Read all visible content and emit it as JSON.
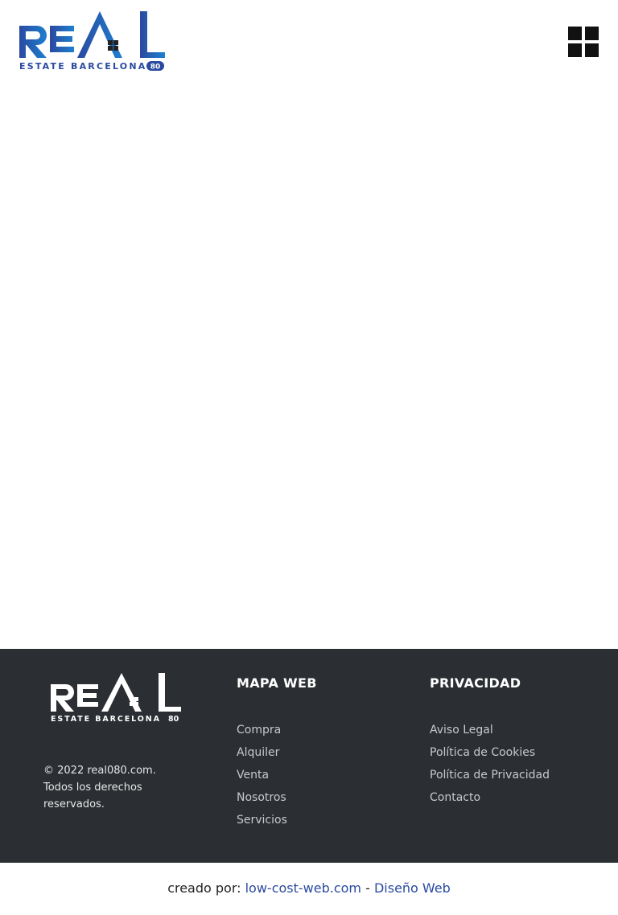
{
  "header": {
    "logo": {
      "word": "REAL",
      "tagline": "ESTATE BARCELONA",
      "badge": "80",
      "color_main": "#2a4aa0",
      "color_accent": "#1e7fd0"
    },
    "menu_icon": "grid-menu-icon"
  },
  "footer": {
    "background": "#2b2f33",
    "logo": {
      "word": "REAL",
      "tagline": "ESTATE BARCELONA",
      "badge": "80"
    },
    "copyright": "© 2022 real080.com. Todos los derechos reservados.",
    "mapa_web": {
      "title": "MAPA WEB",
      "links": [
        "Compra",
        "Alquiler",
        "Venta",
        "Nosotros",
        "Servicios"
      ]
    },
    "privacidad": {
      "title": "PRIVACIDAD",
      "links": [
        "Aviso Legal",
        "Política de Cookies",
        "Política de Privacidad",
        "Contacto"
      ]
    }
  },
  "credit": {
    "prefix": "creado por: ",
    "link1": "low-cost-web.com",
    "separator": " - ",
    "link2": "Diseño Web",
    "link_color": "#2a4aa0"
  }
}
